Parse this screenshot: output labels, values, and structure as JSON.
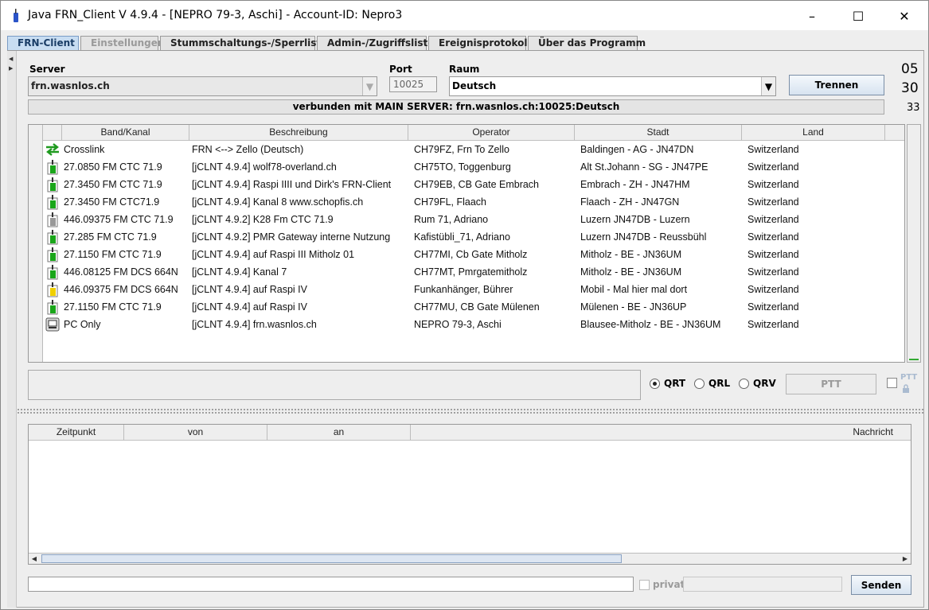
{
  "window": {
    "title": "Java FRN_Client V 4.9.4 - [NEPRO 79-3, Aschi] - Account-ID: Nepro3",
    "minimize": "–",
    "maximize": "☐",
    "close": "✕"
  },
  "tabs": [
    {
      "label": "FRN-Client"
    },
    {
      "label": "Einstellungen"
    },
    {
      "label": "Stummschaltungs-/Sperrliste"
    },
    {
      "label": "Admin-/Zugriffsliste"
    },
    {
      "label": "Ereignisprotokoll"
    },
    {
      "label": "Über das Programm"
    }
  ],
  "connection": {
    "server_label": "Server",
    "server_value": "frn.wasnlos.ch",
    "port_label": "Port",
    "port_value": "10025",
    "room_label": "Raum",
    "room_value": "Deutsch",
    "disconnect_button": "Trennen",
    "counter_top": "05",
    "counter_mid": "30",
    "counter_small": "33",
    "status": "verbunden mit  MAIN SERVER: frn.wasnlos.ch:10025:Deutsch"
  },
  "users_table": {
    "columns": [
      "Band/Kanal",
      "Beschreibung",
      "Operator",
      "Stadt",
      "Land"
    ],
    "rows": [
      {
        "icon": "crosslink-icon",
        "band": "Crosslink",
        "desc": "FRN <--> Zello (Deutsch)",
        "operator": "CH79FZ, Frn To Zello",
        "city": "Baldingen - AG - JN47DN",
        "country": "Switzerland"
      },
      {
        "icon": "radio-green-icon",
        "band": "27.0850 FM CTC 71.9",
        "desc": "[jCLNT 4.9.4] wolf78-overland.ch",
        "operator": "CH75TO, Toggenburg",
        "city": "Alt St.Johann - SG - JN47PE",
        "country": "Switzerland"
      },
      {
        "icon": "radio-green-icon",
        "band": "27.3450 FM CTC 71.9",
        "desc": "[jCLNT 4.9.4]  Raspi IIII und Dirk's FRN-Client",
        "operator": "CH79EB, CB Gate Embrach",
        "city": "Embrach - ZH - JN47HM",
        "country": "Switzerland"
      },
      {
        "icon": "radio-green-icon",
        "band": "27.3450 FM CTC71.9",
        "desc": "[jCLNT 4.9.4]   Kanal 8  www.schopfis.ch",
        "operator": "CH79FL, Flaach",
        "city": "Flaach - ZH - JN47GN",
        "country": "Switzerland"
      },
      {
        "icon": "radio-gray-icon",
        "band": "446.09375 FM CTC 71.9",
        "desc": "[jCLNT 4.9.2] K28 Fm CTC 71.9",
        "operator": "Rum 71, Adriano",
        "city": "Luzern JN47DB - Luzern",
        "country": "Switzerland"
      },
      {
        "icon": "radio-green-icon",
        "band": "27.285 FM CTC 71.9",
        "desc": "[jCLNT 4.9.2] PMR Gateway interne Nutzung",
        "operator": "Kafistübli_71, Adriano",
        "city": "Luzern JN47DB - Reussbühl",
        "country": "Switzerland"
      },
      {
        "icon": "radio-green-icon",
        "band": "27.1150 FM CTC 71.9",
        "desc": "[jCLNT 4.9.4]  auf Raspi III  Mitholz 01",
        "operator": "CH77MI, Cb Gate Mitholz",
        "city": "Mitholz - BE - JN36UM",
        "country": "Switzerland"
      },
      {
        "icon": "radio-green-icon",
        "band": "446.08125 FM DCS 664N",
        "desc": "[jCLNT 4.9.4] Kanal 7",
        "operator": "CH77MT, Pmrgatemitholz",
        "city": "Mitholz - BE - JN36UM",
        "country": "Switzerland"
      },
      {
        "icon": "radio-yellow-icon",
        "band": "446.09375 FM DCS 664N",
        "desc": "[jCLNT 4.9.4] auf Raspi IV",
        "operator": "Funkanhänger, Bührer",
        "city": "Mobil - Mal hier mal dort",
        "country": "Switzerland"
      },
      {
        "icon": "radio-green-icon",
        "band": "27.1150 FM CTC 71.9",
        "desc": "[jCLNT 4.9.4] auf Raspi IV",
        "operator": "CH77MU, CB Gate Mülenen",
        "city": "Mülenen - BE - JN36UP",
        "country": "Switzerland"
      },
      {
        "icon": "pc-icon",
        "band": "PC Only",
        "desc": "[jCLNT 4.9.4] frn.wasnlos.ch",
        "operator": "NEPRO 79-3, Aschi",
        "city": "Blausee-Mitholz - BE - JN36UM",
        "country": "Switzerland"
      }
    ]
  },
  "ptt": {
    "radio_qrt": "QRT",
    "radio_qrl": "QRL",
    "radio_qrv": "QRV",
    "selected": "QRT",
    "ptt_button": "PTT",
    "ptt_lock_label": "PTT"
  },
  "messages_table": {
    "columns": [
      "Zeitpunkt",
      "von",
      "an",
      "Nachricht"
    ]
  },
  "message_bar": {
    "input_value": "",
    "privat_label": "privat",
    "send_button": "Senden"
  }
}
